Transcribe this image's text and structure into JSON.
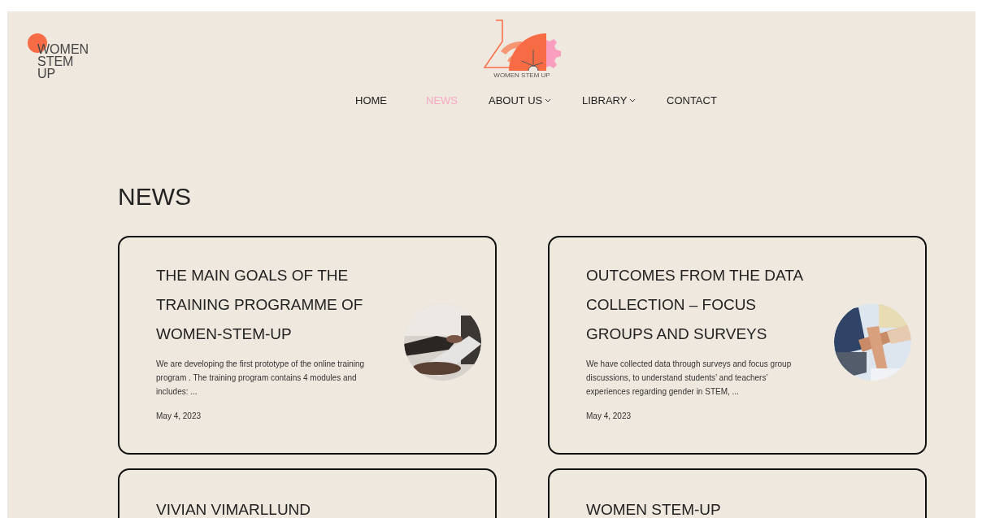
{
  "logo": {
    "text_lines": [
      "WOMEN",
      "STEM",
      "UP"
    ]
  },
  "center_logo": {
    "caption": "WOMEN STEM UP"
  },
  "nav": [
    {
      "label": "HOME",
      "selected": false,
      "dropdown": false
    },
    {
      "label": "NEWS",
      "selected": true,
      "dropdown": false
    },
    {
      "label": "ABOUT US",
      "selected": false,
      "dropdown": true
    },
    {
      "label": "LIBRARY",
      "selected": false,
      "dropdown": true
    },
    {
      "label": "CONTACT",
      "selected": false,
      "dropdown": false
    }
  ],
  "heading": "NEWS",
  "posts": [
    {
      "title": "THE MAIN GOALS OF THE TRAINING PROGRAMME OF WOMEN-STEM-UP",
      "excerpt": "We are developing the first prototype of the online training program . The training program contains 4 modules  and includes: ...",
      "date": "May 4, 2023"
    },
    {
      "title": "OUTCOMES FROM THE DATA COLLECTION – FOCUS GROUPS AND SURVEYS",
      "excerpt": "We have collected data through surveys and focus group discussions, to understand students’ and teachers’ experiences regarding gender in STEM, ...",
      "date": "May 4, 2023"
    },
    {
      "title": "VIVIAN VIMARLLUND"
    },
    {
      "title": "WOMEN STEM-UP"
    }
  ]
}
